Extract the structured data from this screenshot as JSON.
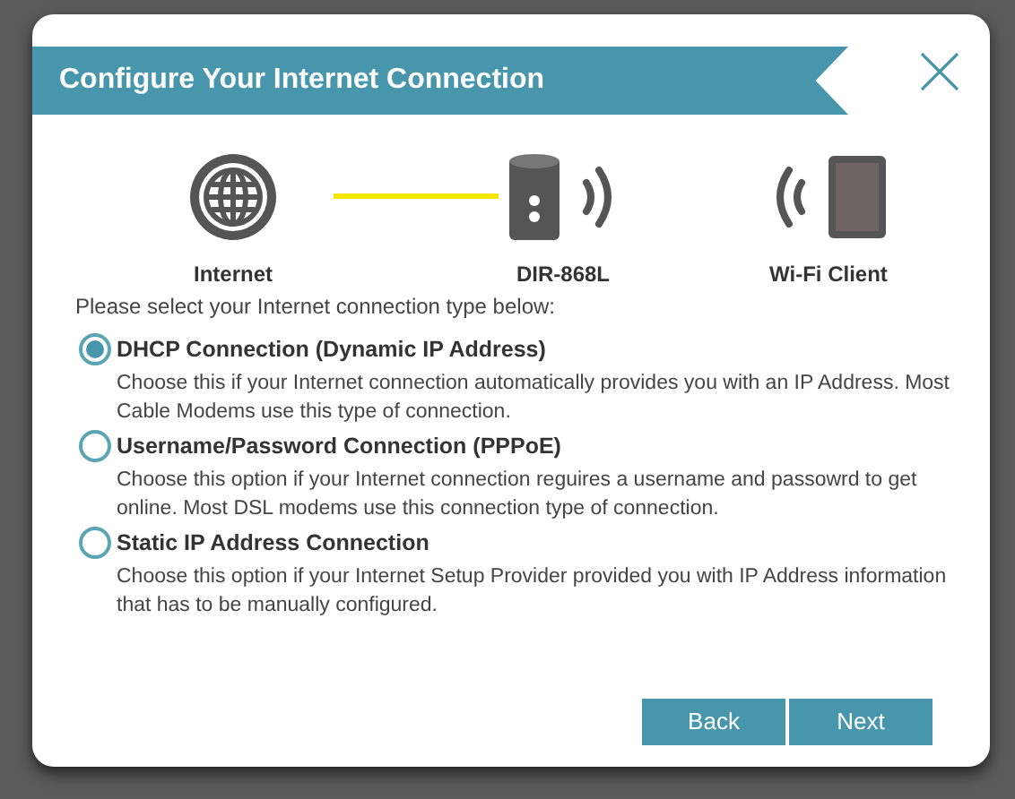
{
  "dialog": {
    "title": "Configure Your Internet Connection"
  },
  "devices": [
    {
      "label": "Internet",
      "kind": "globe"
    },
    {
      "label": "DIR-868L",
      "kind": "router"
    },
    {
      "label": "Wi-Fi Client",
      "kind": "tablet"
    }
  ],
  "prompt": "Please select your Internet connection type below:",
  "options": [
    {
      "label": "DHCP Connection (Dynamic IP Address)",
      "description": "Choose this if your Internet connection automatically provides you with an IP Address. Most Cable Modems use this type of connection.",
      "selected": true
    },
    {
      "label": "Username/Password Connection (PPPoE)",
      "description": "Choose this option if your Internet connection reguires a username and passowrd to get online. Most DSL modems use this connection type of connection.",
      "selected": false
    },
    {
      "label": "Static IP Address Connection",
      "description": "Choose this option if your Internet Setup Provider provided you with IP Address information that has to be manually configured.",
      "selected": false
    }
  ],
  "buttons": [
    "Back",
    "Next"
  ]
}
